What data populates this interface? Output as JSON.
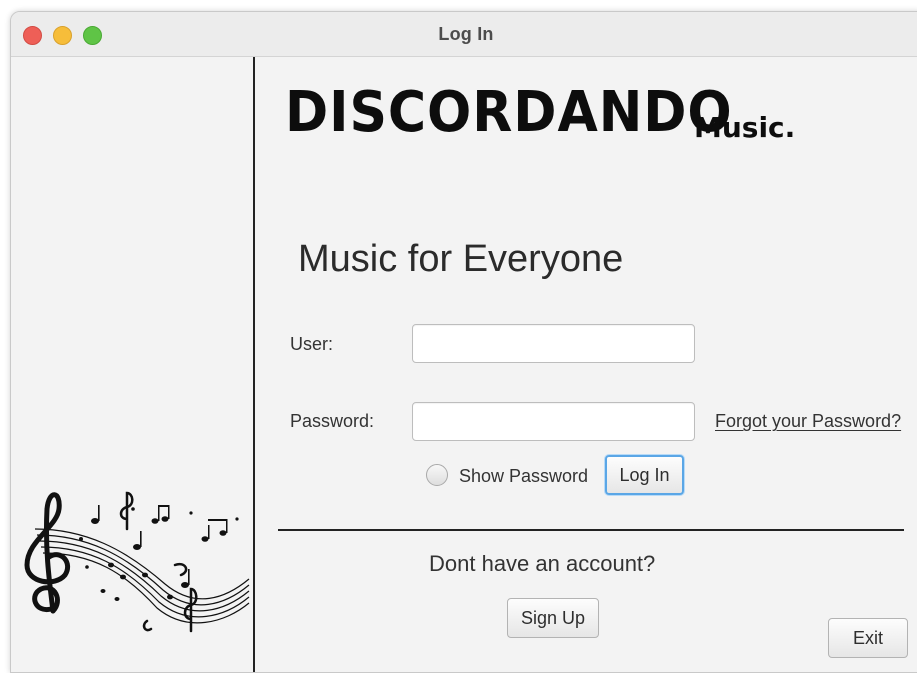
{
  "window": {
    "title": "Log In"
  },
  "brand": {
    "name": "DISCORDANDO",
    "suffix": "Music."
  },
  "tagline": "Music for Everyone",
  "form": {
    "user_label": "User:",
    "user_value": "",
    "password_label": "Password:",
    "password_value": "",
    "forgot_link": "Forgot your Password?",
    "show_password_label": "Show Password",
    "show_password_checked": false,
    "login_button": "Log In"
  },
  "signup": {
    "prompt": "Dont have an account?",
    "button": "Sign Up"
  },
  "exit_button": "Exit",
  "colors": {
    "close": "#ee5f57",
    "minimize": "#f6bd3a",
    "maximize": "#5fc446",
    "focus_ring": "#5aa6e6"
  },
  "icons": [
    "music-notes-illustration",
    "treble-clef-icon"
  ]
}
